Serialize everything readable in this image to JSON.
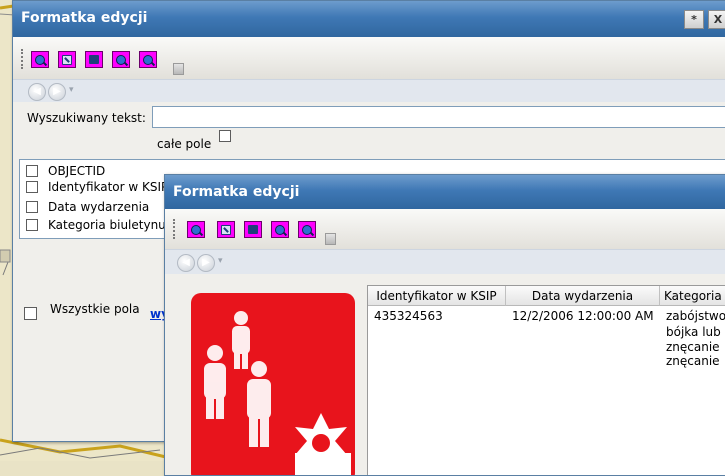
{
  "colors": {
    "titlebar": "#3f78b5",
    "toolbar_icon": "#ff00ff",
    "photo_background": "#e8141c",
    "link": "#0033cc"
  },
  "back_window": {
    "title": "Formatka edycji",
    "buttons": {
      "pin": "*",
      "close": "X"
    },
    "toolbar_icons": [
      "zoom-in-icon",
      "full-extent-icon",
      "zoom-to-layer-icon",
      "zoom-in-icon",
      "zoom-out-icon"
    ],
    "search": {
      "label": "Wyszukiwany tekst:",
      "value": ""
    },
    "whole_field": {
      "label": "całe pole",
      "checked": false
    },
    "fields": [
      {
        "label": "OBJECTID",
        "checked": false
      },
      {
        "label": "Identyfikator w KSIP",
        "checked": false
      },
      {
        "label": "Data wydarzenia",
        "checked": false
      },
      {
        "label": "Kategoria biuletynu",
        "checked": false
      }
    ],
    "all_fields": {
      "label": "Wszystkie pola",
      "checked": false
    },
    "link_text": "wy"
  },
  "front_window": {
    "title": "Formatka edycji",
    "toolbar_icons": [
      "zoom-in-icon",
      "full-extent-icon",
      "zoom-to-layer-icon",
      "zoom-in-icon",
      "zoom-out-icon"
    ],
    "table": {
      "columns": [
        "Identyfikator w KSIP",
        "Data wydarzenia",
        "Kategoria"
      ],
      "rows": [
        {
          "id": "435324563",
          "date": "12/2/2006 12:00:00 AM",
          "category": [
            "zabójstwo",
            "bójka lub",
            "znęcanie",
            "znęcanie"
          ]
        }
      ]
    }
  }
}
